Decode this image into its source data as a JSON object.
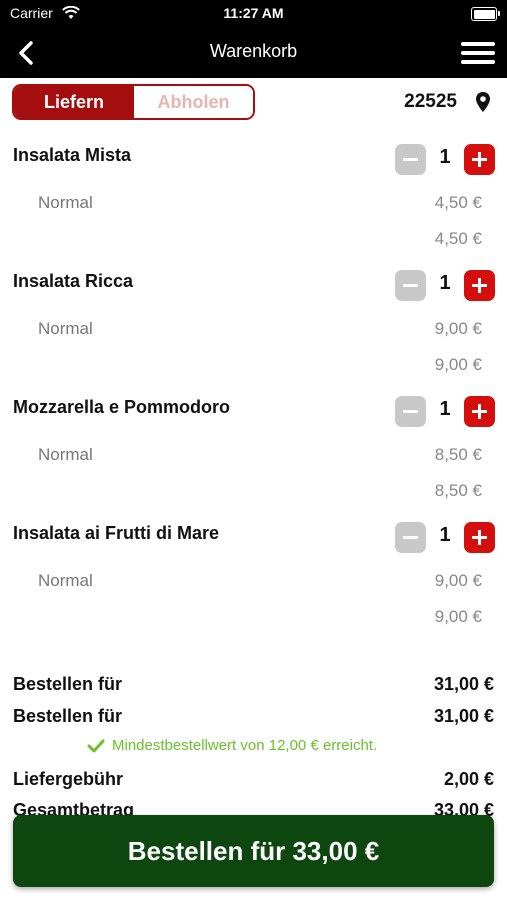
{
  "status_bar": {
    "carrier": "Carrier",
    "time": "11:27 AM"
  },
  "nav": {
    "title": "Warenkorb"
  },
  "delivery_toggle": {
    "options": [
      "Liefern",
      "Abholen"
    ],
    "selected": "Liefern"
  },
  "location": {
    "postcode": "22525"
  },
  "cart_items": [
    {
      "name": "Insalata Mista",
      "quantity": "1",
      "variant": "Normal",
      "unit_price": "4,50 €",
      "line_total": "4,50 €"
    },
    {
      "name": "Insalata Ricca",
      "quantity": "1",
      "variant": "Normal",
      "unit_price": "9,00 €",
      "line_total": "9,00 €"
    },
    {
      "name": "Mozzarella e Pommodoro",
      "quantity": "1",
      "variant": "Normal",
      "unit_price": "8,50 €",
      "line_total": "8,50 €"
    },
    {
      "name": "Insalata ai Frutti di Mare",
      "quantity": "1",
      "variant": "Normal",
      "unit_price": "9,00 €",
      "line_total": "9,00 €"
    }
  ],
  "summary": {
    "rows": [
      {
        "label": "Bestellen für",
        "value": "31,00 €"
      },
      {
        "label": "Bestellen für",
        "value": "31,00 €"
      },
      {
        "label": "Liefergebühr",
        "value": "2,00 €"
      },
      {
        "label": "Gesamtbetrag",
        "value": "33,00 €"
      }
    ],
    "min_order_note": "Mindestbestellwert von 12,00 € erreicht."
  },
  "checkout_button": {
    "label": "Bestellen für 33,00 €"
  },
  "colors": {
    "brand_red": "#a50e0e",
    "plus_red": "#d40d0d",
    "success_green": "#6ac12d",
    "cta_green": "#0e4610"
  },
  "icons": {
    "back": "chevron-left-icon",
    "menu": "hamburger-menu-icon",
    "location": "location-pin-icon",
    "check": "checkmark-icon"
  }
}
